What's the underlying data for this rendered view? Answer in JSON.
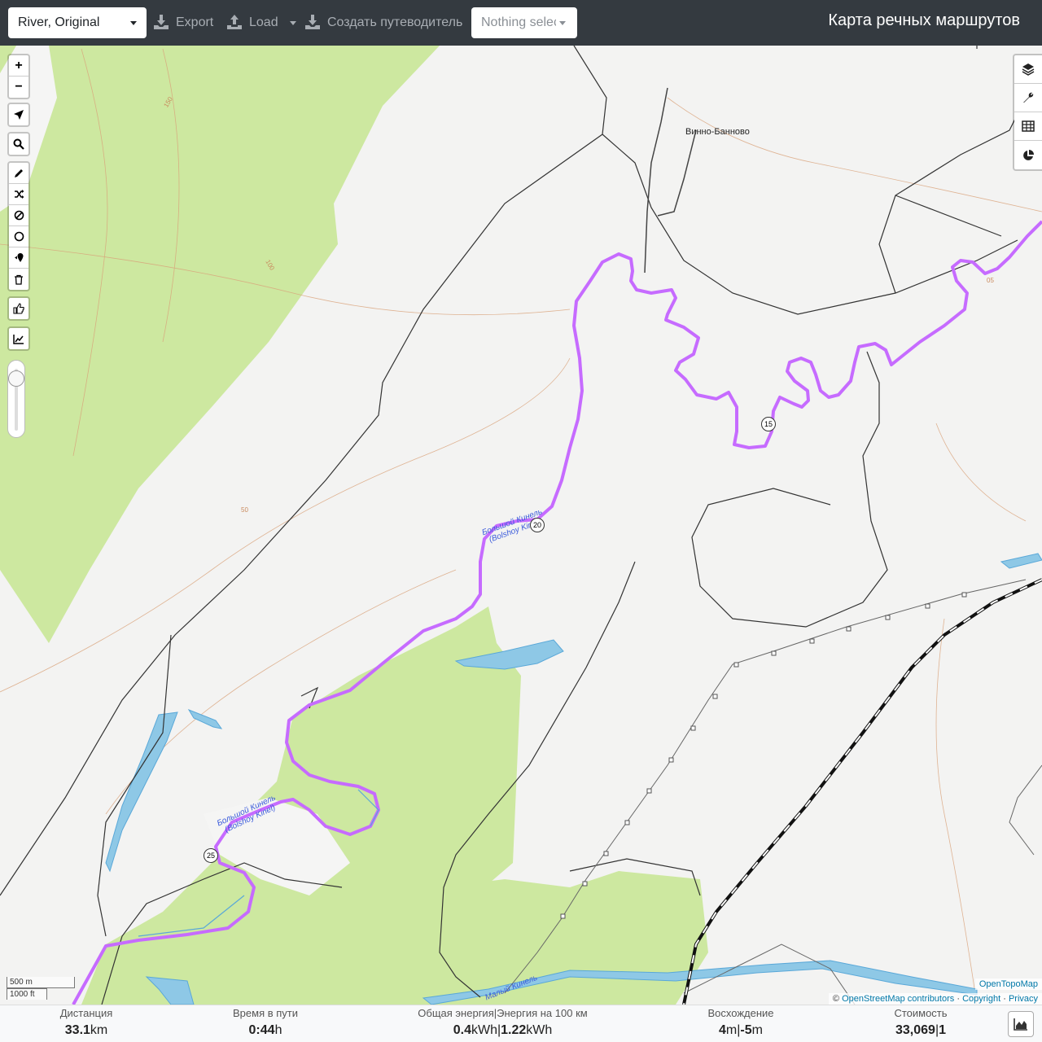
{
  "navbar": {
    "profile": "River, Original",
    "export_label": "Export",
    "load_label": "Load",
    "guide_label": "Создать путеводитель",
    "selection_placeholder": "Nothing selected",
    "brand": "Карта речных маршрутов"
  },
  "map": {
    "zoom_in": "+",
    "zoom_out": "−",
    "labels": {
      "village": "Винно-Банново",
      "river_upper_ru": "Большой Кинель",
      "river_upper_en": "(Bolshoy Kinel)",
      "river_lower_ru": "Большой Кинель",
      "river_lower_en": "(Bolshoy Kinel)",
      "river_small": "Малый Кинель",
      "km15": "15",
      "km20": "20",
      "km25": "25",
      "contour_100": "100",
      "contour_150": "150",
      "contour_50": "50",
      "contour_05": "05"
    },
    "scale_metric": "500 m",
    "scale_imperial": "1000 ft",
    "attribution_otm": "OpenTopoMap",
    "attribution_prefix": "©",
    "attribution_osm": "OpenStreetMap contributors",
    "attribution_sep1": "·",
    "attribution_copyright": "Copyright",
    "attribution_sep2": "·",
    "attribution_privacy": "Privacy",
    "route_color": "#cc33ff",
    "forest_color": "#cde8a0",
    "water_color": "#8ec8e6"
  },
  "stats": {
    "distance": {
      "title": "Дистанция",
      "value": "33.1",
      "unit": "km"
    },
    "time": {
      "title": "Время в пути",
      "value": "0:44",
      "unit": "h"
    },
    "energy": {
      "title": "Общая энергия|Энергия на 100 км",
      "value1": "0.4",
      "unit1": "kWh",
      "sep": "|",
      "value2": "1.22",
      "unit2": "kWh"
    },
    "ascent": {
      "title": "Восхождение",
      "value1": "4",
      "unit1": "m",
      "sep": "|",
      "value2": "-5",
      "unit2": "m"
    },
    "cost": {
      "title": "Стоимость",
      "value": "33,069",
      "sep": "|",
      "value2": "1"
    }
  }
}
